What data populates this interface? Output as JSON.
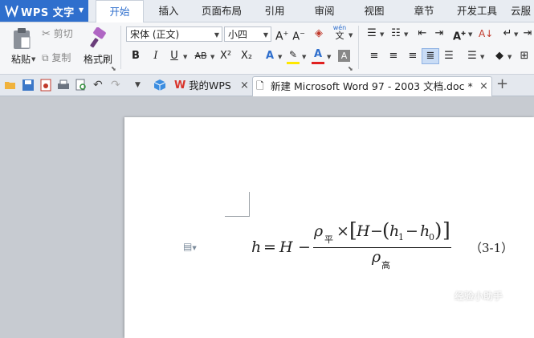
{
  "app": {
    "title": "WPS 文字",
    "brand_color": "#2f6fcd"
  },
  "menu_tabs": [
    {
      "label": "开始",
      "active": true
    },
    {
      "label": "插入"
    },
    {
      "label": "页面布局"
    },
    {
      "label": "引用"
    },
    {
      "label": "审阅"
    },
    {
      "label": "视图"
    },
    {
      "label": "章节"
    },
    {
      "label": "开发工具"
    },
    {
      "label": "云服"
    }
  ],
  "ribbon": {
    "paste_label": "粘贴",
    "cut_label": "剪切",
    "copy_label": "复制",
    "format_painter_label": "格式刷",
    "font_name": "宋体 (正文)",
    "font_size": "小四",
    "phonetic_top": "wén",
    "phonetic_bottom": "文",
    "bold": "B",
    "italic": "I",
    "underline": "U",
    "strike": "AB",
    "superscript": "X²",
    "subscript": "X₂",
    "font_color_letter": "A",
    "highlight_color": "#ffe800",
    "font_color": "#e02020"
  },
  "quick_access_icons": [
    "open-icon",
    "save-icon",
    "export-pdf-icon",
    "print-icon",
    "print-preview-icon",
    "undo-icon",
    "redo-icon",
    "more-icon"
  ],
  "doc_tabs": [
    {
      "label": "我的WPS",
      "active": false
    },
    {
      "label": "新建 Microsoft Word 97 - 2003 文档.doc *",
      "active": true
    }
  ],
  "document": {
    "equation": {
      "lhs": "h",
      "eq": "=",
      "H1": "H",
      "minus": "−",
      "rho": "ρ",
      "sub_ping": "平",
      "sub_gao": "高",
      "times": "×",
      "H2": "H",
      "h1": "h",
      "sub1": "1",
      "h0": "h",
      "sub0": "0"
    },
    "equation_number": "（3-1）"
  },
  "watermark": "经验小助手"
}
